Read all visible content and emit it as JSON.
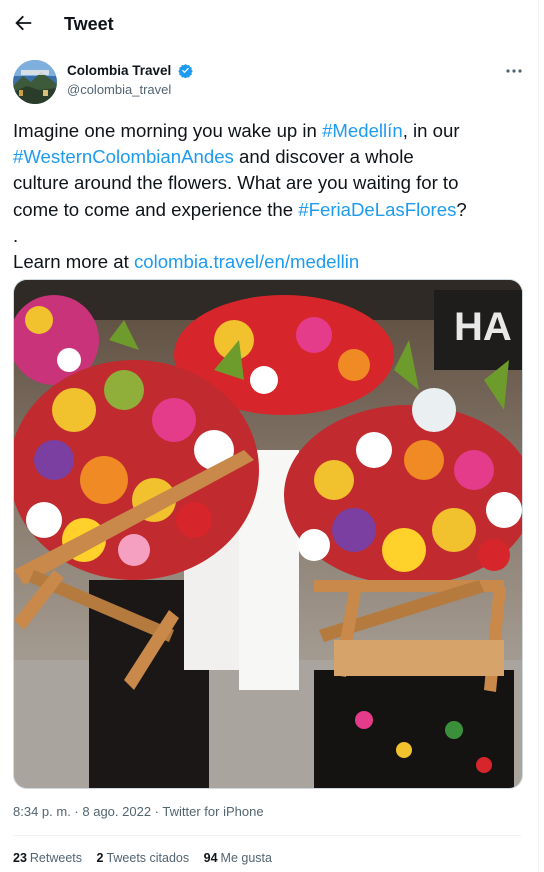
{
  "header": {
    "title": "Tweet"
  },
  "author": {
    "name": "Colombia Travel",
    "handle": "@colombia_travel"
  },
  "tweet": {
    "l1_a": "Imagine one morning you wake up in ",
    "l1_link": "#Medellín",
    "l1_b": ", in our",
    "l2_link": "#WesternColombianAndes",
    "l2_b": " and discover a whole",
    "l3": "culture around the flowers. What are you waiting for to",
    "l4_a": "come  to come and experience the ",
    "l4_link": "#FeriaDeLasFlores",
    "l4_b": "?",
    "l5": ".",
    "l6_a": "Learn more at ",
    "l6_link": "colombia.travel/en/medellin"
  },
  "meta": {
    "time": "8:34 p. m.",
    "sep1": " · ",
    "date": "8 ago. 2022",
    "sep2": " · ",
    "source": "Twitter for iPhone"
  },
  "stats": [
    {
      "count": "23",
      "label": "Retweets"
    },
    {
      "count": "2",
      "label": "Tweets citados"
    },
    {
      "count": "94",
      "label": "Me gusta"
    }
  ],
  "colors": {
    "link": "#1d9bf0",
    "secondary_text": "#536471",
    "verified": "#1d9bf0"
  },
  "icons": {
    "back": "arrow-left-icon",
    "verified": "verified-badge-icon",
    "more": "more-dots-icon"
  }
}
